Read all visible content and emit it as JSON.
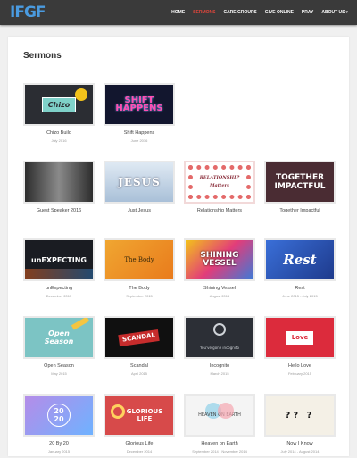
{
  "header": {
    "logo_text": "IFGF",
    "nav": [
      {
        "label": "HOME",
        "active": false
      },
      {
        "label": "SERMONS",
        "active": true
      },
      {
        "label": "CARE GROUPS",
        "active": false
      },
      {
        "label": "GIVE ONLINE",
        "active": false
      },
      {
        "label": "PRAY",
        "active": false
      },
      {
        "label": "ABOUT US",
        "active": false,
        "caret": "▾"
      }
    ]
  },
  "main": {
    "title": "Sermons",
    "sermons": [
      {
        "title": "Chizo Build",
        "date": "July 2016",
        "thumb_text": "Chizo",
        "theme": "chizo"
      },
      {
        "title": "Shift Happens",
        "date": "June 2016",
        "thumb_text": "SHIFT\nHAPPENS",
        "theme": "shift"
      },
      {
        "title": "Guest Speaker 2016",
        "date": "",
        "thumb_text": "",
        "theme": "guest"
      },
      {
        "title": "Just Jesus",
        "date": "",
        "thumb_text": "JESUS",
        "theme": "jesus"
      },
      {
        "title": "Relationship Matters",
        "date": "",
        "thumb_text": "RELATIONSHIP\nMatters",
        "theme": "rel"
      },
      {
        "title": "Together Impactful",
        "date": "",
        "thumb_text": "TOGETHER\nIMPACTFUL",
        "theme": "together"
      },
      {
        "title": "unExpecting",
        "date": "December 2015",
        "thumb_text": "unEXPECTING",
        "theme": "unexp"
      },
      {
        "title": "The Body",
        "date": "September 2015",
        "thumb_text": "The Body",
        "theme": "body"
      },
      {
        "title": "Shining Vessel",
        "date": "August 2015",
        "thumb_text": "SHINING\nVESSEL",
        "theme": "shining"
      },
      {
        "title": "Rest",
        "date": "June 2015 - July 2015",
        "thumb_text": "Rest",
        "theme": "rest"
      },
      {
        "title": "Open Season",
        "date": "May 2015",
        "thumb_text": "Open\nSeason",
        "theme": "open"
      },
      {
        "title": "Scandal",
        "date": "April 2015",
        "thumb_text": "SCANDAL",
        "theme": "scandal"
      },
      {
        "title": "Incognito",
        "date": "March 2015",
        "thumb_text": "You've gone incognito",
        "theme": "incog"
      },
      {
        "title": "Hello Love",
        "date": "February 2015",
        "thumb_text": "Love",
        "theme": "hello"
      },
      {
        "title": "20 By 20",
        "date": "January 2015",
        "thumb_text": "20\n20",
        "theme": "2020"
      },
      {
        "title": "Glorious Life",
        "date": "December 2014",
        "thumb_text": "GLORIOUS\nLIFE",
        "theme": "glorious"
      },
      {
        "title": "Heaven on Earth",
        "date": "September 2014 - November 2014",
        "thumb_text": "HEAVEN ON EARTH",
        "theme": "heaven"
      },
      {
        "title": "Now I Know",
        "date": "July 2014 - August 2014",
        "thumb_text": "?? ?",
        "theme": "nowi"
      }
    ]
  }
}
